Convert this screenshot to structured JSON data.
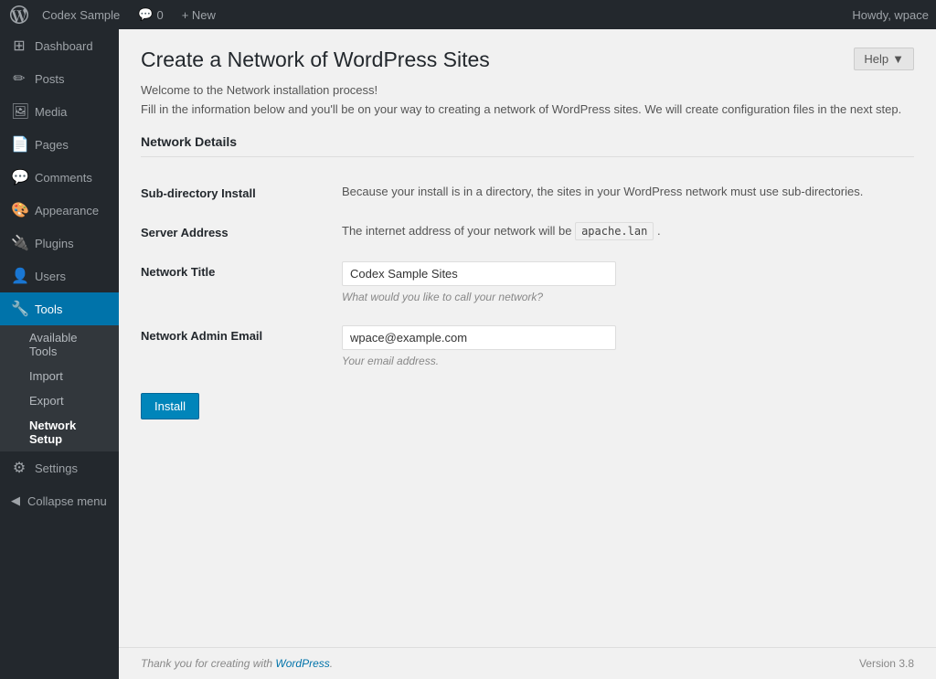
{
  "adminbar": {
    "site_name": "Codex Sample",
    "comments_count": "0",
    "new_label": "+ New",
    "howdy": "Howdy, wpace"
  },
  "help_button": "Help",
  "sidebar": {
    "items": [
      {
        "id": "dashboard",
        "label": "Dashboard",
        "icon": "⊞"
      },
      {
        "id": "posts",
        "label": "Posts",
        "icon": "✏"
      },
      {
        "id": "media",
        "label": "Media",
        "icon": "🖼"
      },
      {
        "id": "pages",
        "label": "Pages",
        "icon": "📄"
      },
      {
        "id": "comments",
        "label": "Comments",
        "icon": "💬"
      },
      {
        "id": "appearance",
        "label": "Appearance",
        "icon": "🎨"
      },
      {
        "id": "plugins",
        "label": "Plugins",
        "icon": "🔌"
      },
      {
        "id": "users",
        "label": "Users",
        "icon": "👤"
      },
      {
        "id": "tools",
        "label": "Tools",
        "icon": "🔧"
      },
      {
        "id": "settings",
        "label": "Settings",
        "icon": "⚙"
      }
    ],
    "tools_submenu": [
      {
        "id": "available-tools",
        "label": "Available Tools"
      },
      {
        "id": "import",
        "label": "Import"
      },
      {
        "id": "export",
        "label": "Export"
      },
      {
        "id": "network-setup",
        "label": "Network Setup"
      }
    ],
    "collapse_label": "Collapse menu"
  },
  "page": {
    "title": "Create a Network of WordPress Sites",
    "welcome_line1": "Welcome to the Network installation process!",
    "welcome_line2": "Fill in the information below and you'll be on your way to creating a network of WordPress sites. We will create configuration files in the next step.",
    "section_title": "Network Details",
    "fields": [
      {
        "id": "subdirectory-install",
        "label": "Sub-directory Install",
        "description": "Because your install is in a directory, the sites in your WordPress network must use sub-directories.",
        "type": "text"
      },
      {
        "id": "server-address",
        "label": "Server Address",
        "description_prefix": "The internet address of your network will be ",
        "code_value": "apache.lan",
        "description_suffix": ".",
        "type": "server"
      },
      {
        "id": "network-title",
        "label": "Network Title",
        "value": "Codex Sample Sites",
        "hint": "What would you like to call your network?",
        "type": "input"
      },
      {
        "id": "network-admin-email",
        "label": "Network Admin Email",
        "value": "wpace@example.com",
        "hint": "Your email address.",
        "type": "input"
      }
    ],
    "install_button": "Install"
  },
  "footer": {
    "thank_you": "Thank you for creating with ",
    "wp_link_text": "WordPress",
    "version": "Version 3.8"
  }
}
